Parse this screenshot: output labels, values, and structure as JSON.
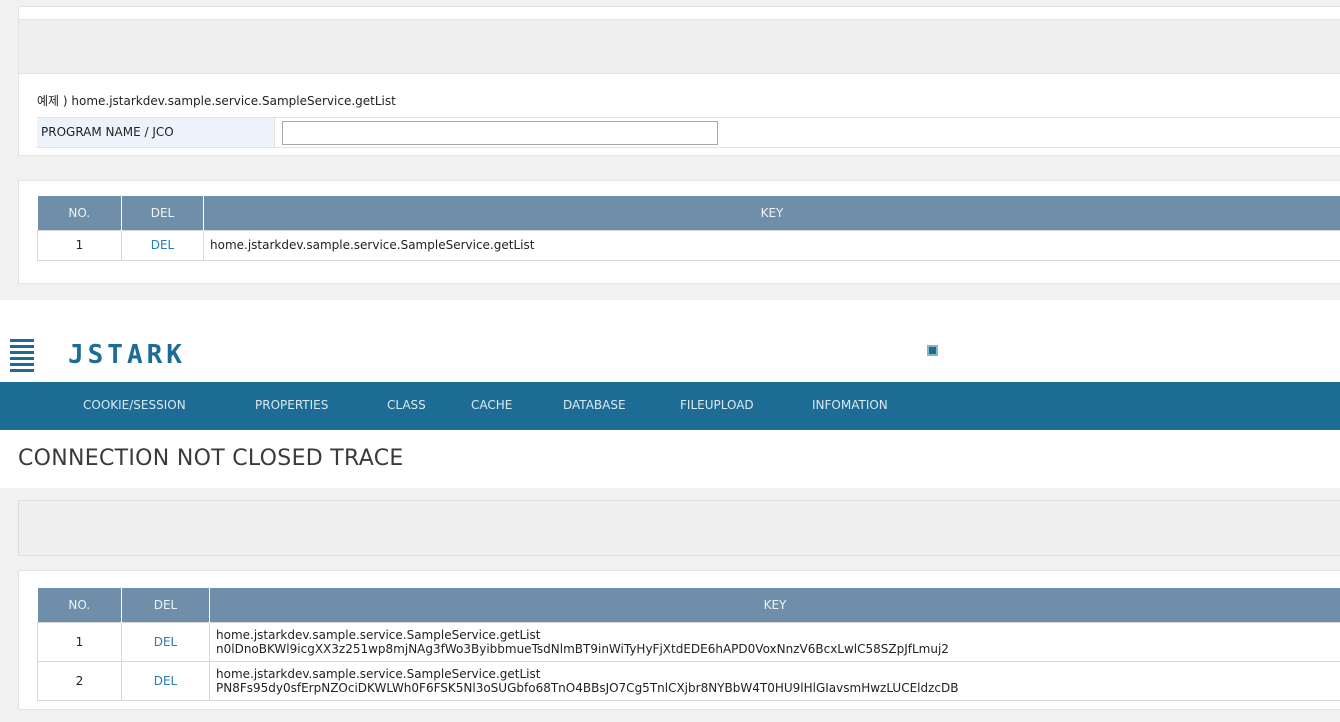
{
  "top": {
    "example_text": "예제 ) home.jstarkdev.sample.service.SampleService.getList",
    "program_label": "PROGRAM NAME / JCO",
    "program_value": "",
    "table": {
      "headers": [
        "NO.",
        "DEL",
        "KEY"
      ],
      "rows": [
        {
          "no": "1",
          "del": "DEL",
          "key": "home.jstarkdev.sample.service.SampleService.getList"
        }
      ]
    }
  },
  "header": {
    "logo": "JSTARK",
    "nav": [
      "COOKIE/SESSION",
      "PROPERTIES",
      "CLASS",
      "CACHE",
      "DATABASE",
      "FILEUPLOAD",
      "INFOMATION"
    ]
  },
  "page_title": "CONNECTION NOT CLOSED TRACE",
  "bottom": {
    "table": {
      "headers": [
        "NO.",
        "DEL",
        "KEY"
      ],
      "rows": [
        {
          "no": "1",
          "del": "DEL",
          "key_line1": "home.jstarkdev.sample.service.SampleService.getList",
          "key_line2": "n0lDnoBKWl9icgXX3z251wp8mjNAg3fWo3ByibbmueTsdNlmBT9inWiTyHyFjXtdEDE6hAPD0VoxNnzV6BcxLwlC58SZpJfLmuj2"
        },
        {
          "no": "2",
          "del": "DEL",
          "key_line1": "home.jstarkdev.sample.service.SampleService.getList",
          "key_line2": "PN8Fs95dy0sfErpNZOciDKWLWh0F6FSK5Nl3oSUGbfo68TnO4BBsJO7Cg5TnlCXjbr8NYBbW4T0HU9lHlGIavsmHwzLUCEldzcDB"
        }
      ]
    }
  },
  "icons": {
    "menu": "hamburger-menu-icon",
    "square": "square-icon"
  },
  "colors": {
    "brand": "#1c6c95",
    "table_header": "#6e8ea9",
    "link": "#2a7bb0"
  }
}
